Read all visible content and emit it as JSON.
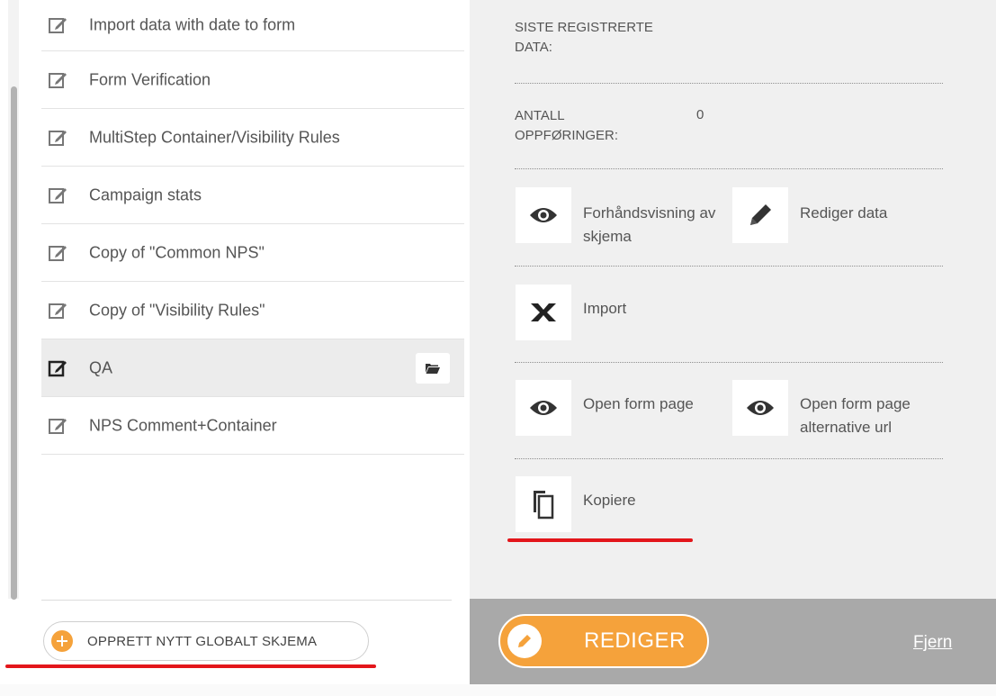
{
  "forms": [
    {
      "label": "Import data with date to form",
      "selected": false
    },
    {
      "label": "Form Verification",
      "selected": false
    },
    {
      "label": "MultiStep Container/Visibility Rules",
      "selected": false
    },
    {
      "label": "Campaign stats",
      "selected": false
    },
    {
      "label": "Copy of \"Common NPS\"",
      "selected": false
    },
    {
      "label": "Copy of \"Visibility Rules\"",
      "selected": false
    },
    {
      "label": "QA",
      "selected": true
    },
    {
      "label": "NPS Comment+Container",
      "selected": false
    }
  ],
  "create_button": {
    "label": "OPPRETT NYTT GLOBALT SKJEMA"
  },
  "details": {
    "last_registered_label": "SISTE REGISTRERTE DATA:",
    "entry_count_label": "ANTALL OPPFØRINGER:",
    "entry_count_value": "0"
  },
  "actions": {
    "preview": "Forhåndsvisning av skjema",
    "edit_data": "Rediger data",
    "import": "Import",
    "open_form_page": "Open form page",
    "open_form_page_alt": "Open form page alternative url",
    "copy": "Kopiere"
  },
  "footer": {
    "edit_button": "REDIGER",
    "remove_link": "Fjern"
  },
  "colors": {
    "accent": "#f5a23b",
    "highlight_underline": "#e3161b",
    "footer_bar": "#a9a9a9"
  },
  "icons": [
    "edit-icon",
    "folder-icon",
    "plus-icon",
    "eye-icon",
    "pencil-icon",
    "excel-icon",
    "copy-icon"
  ]
}
